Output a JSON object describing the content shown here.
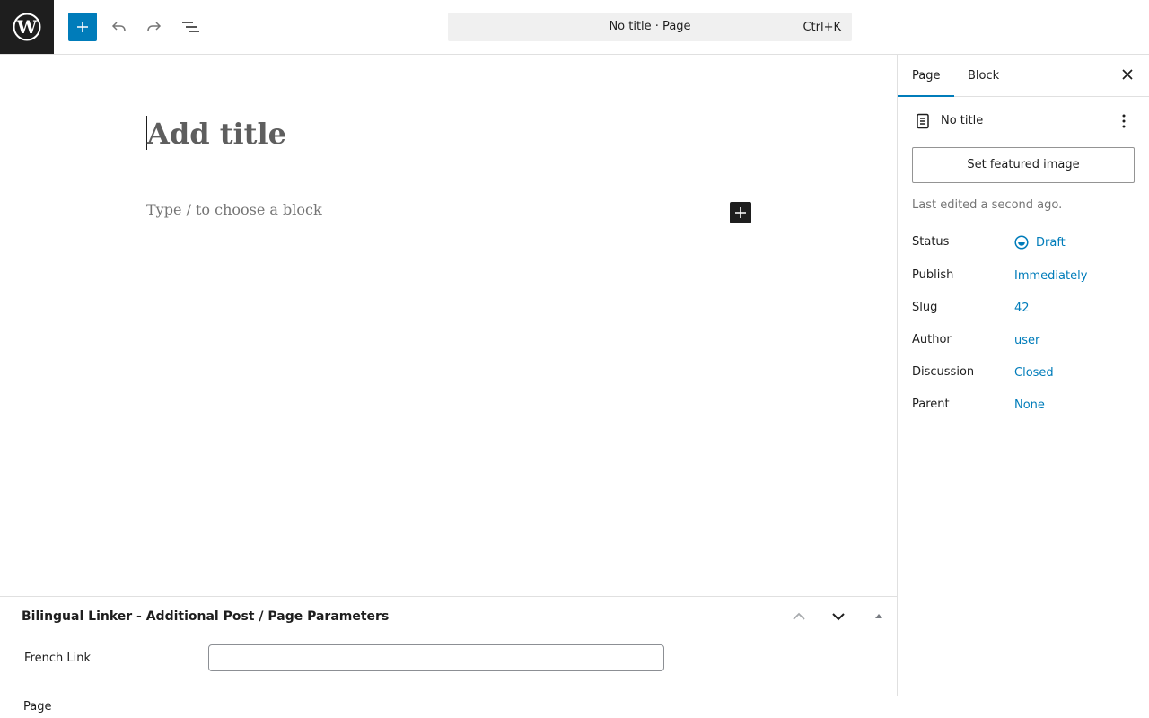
{
  "colors": {
    "accent": "#007cba",
    "dark": "#1e1e1e",
    "muted": "#757575",
    "border": "#e0e0e0"
  },
  "topbar": {
    "command_title": "No title · Page",
    "command_shortcut": "Ctrl+K"
  },
  "editor": {
    "title_placeholder": "Add title",
    "block_placeholder": "Type / to choose a block"
  },
  "metabox": {
    "title": "Bilingual Linker - Additional Post / Page Parameters",
    "field_label": "French Link",
    "field_value": ""
  },
  "footer": {
    "breadcrumb": "Page"
  },
  "sidebar": {
    "tabs": [
      {
        "label": "Page",
        "active": true
      },
      {
        "label": "Block",
        "active": false
      }
    ],
    "document_title": "No title",
    "featured_image_button": "Set featured image",
    "last_edited": "Last edited a second ago.",
    "properties": [
      {
        "label": "Status",
        "value": "Draft"
      },
      {
        "label": "Publish",
        "value": "Immediately"
      },
      {
        "label": "Slug",
        "value": "42"
      },
      {
        "label": "Author",
        "value": "user"
      },
      {
        "label": "Discussion",
        "value": "Closed"
      },
      {
        "label": "Parent",
        "value": "None"
      }
    ]
  }
}
